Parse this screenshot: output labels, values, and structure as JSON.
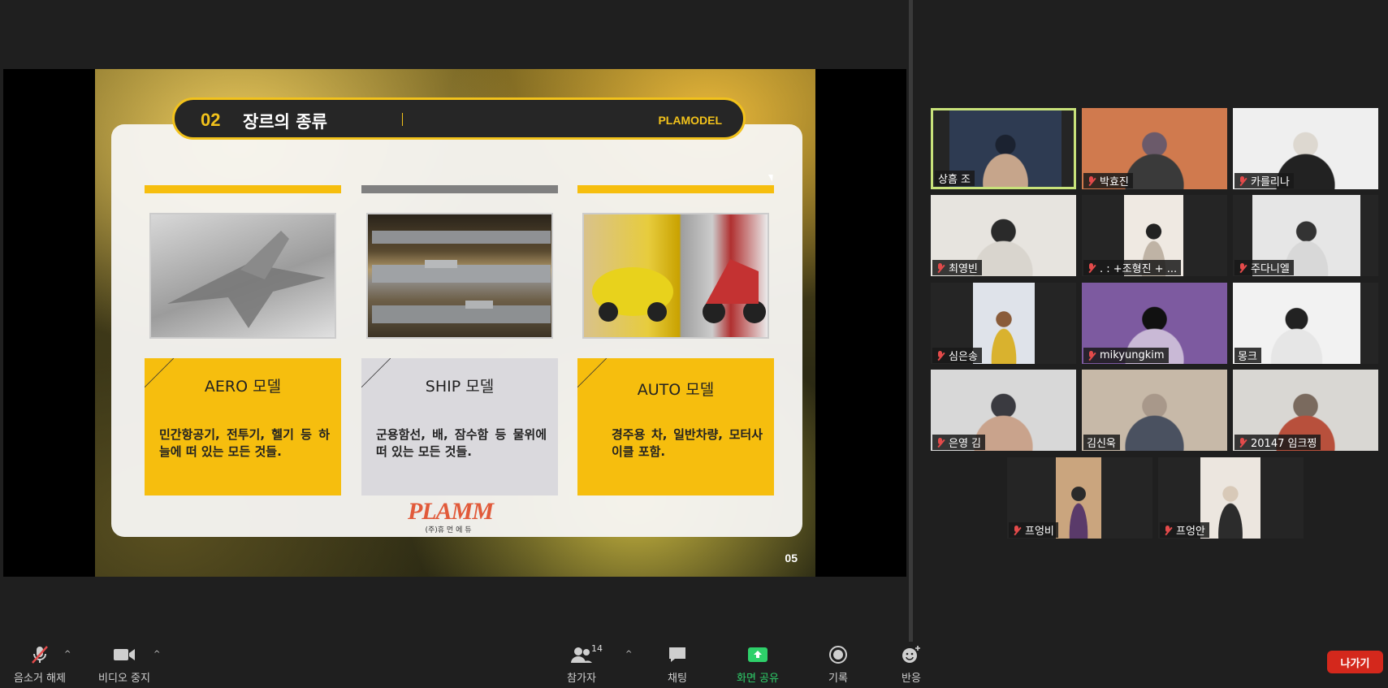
{
  "slide": {
    "number_label": "02",
    "title": "장르의 종류",
    "brand": "PLAMODEL",
    "page": "05",
    "columns": [
      {
        "title": "AERO 모델",
        "desc": "민간항공기, 전투기, 헬기 등 하늘에 떠 있는 모든 것들.",
        "image": "fighter-jet-model"
      },
      {
        "title": "SHIP 모델",
        "desc": "군용함선, 배, 잠수함 등 물위에 떠 있는 모든 것들.",
        "image": "warship-models"
      },
      {
        "title": "AUTO 모델",
        "desc": "경주용 차, 일반차량, 모터사이클 포함.",
        "image": "car-and-motorcycle-models"
      }
    ],
    "logo": {
      "word": "PLAMM",
      "sub": "(주)휴 먼 에 듀"
    }
  },
  "participants": [
    {
      "name": "상흠 조",
      "muted": false,
      "active": true,
      "colors": [
        "#2e3b52",
        "#c6a58b",
        "#1b2230"
      ]
    },
    {
      "name": "박효진",
      "muted": true,
      "active": false,
      "colors": [
        "#d07a4e",
        "#3a3a3a",
        "#6b5a6a"
      ]
    },
    {
      "name": "카를리나",
      "muted": true,
      "active": false,
      "colors": [
        "#efefef",
        "#222222",
        "#ddd8d0"
      ]
    },
    {
      "name": "최영빈",
      "muted": true,
      "active": false,
      "colors": [
        "#e7e4df",
        "#d9d5ce",
        "#2a2a2a"
      ]
    },
    {
      "name": ".      :   +조형진 +   ...",
      "muted": true,
      "active": false,
      "colors": [
        "#efe9e2",
        "#bfb3a5",
        "#222"
      ]
    },
    {
      "name": "주다니엘",
      "muted": true,
      "active": false,
      "colors": [
        "#e6e6e6",
        "#d8d8d8",
        "#333"
      ]
    },
    {
      "name": "심은송",
      "muted": true,
      "active": false,
      "colors": [
        "#dfe3ea",
        "#d9b22e",
        "#8a5c3a"
      ]
    },
    {
      "name": "mikyungkim",
      "muted": true,
      "active": false,
      "colors": [
        "#7d5aa0",
        "#c9b9d6",
        "#111"
      ]
    },
    {
      "name": "몽크",
      "muted": false,
      "active": false,
      "colors": [
        "#f2f2f2",
        "#e6e6e6",
        "#222"
      ]
    },
    {
      "name": "은영 김",
      "muted": true,
      "active": false,
      "colors": [
        "#d8d8d8",
        "#c9a38c",
        "#3a3a40"
      ]
    },
    {
      "name": "김신욱",
      "muted": false,
      "active": false,
      "colors": [
        "#c7b9a8",
        "#4a5160",
        "#a8988a"
      ]
    },
    {
      "name": "20147 임크찡",
      "muted": true,
      "active": false,
      "colors": [
        "#d9d7d3",
        "#b8503c",
        "#7a6a5e"
      ]
    },
    {
      "name": "프엉비",
      "muted": true,
      "active": false,
      "colors": [
        "#caa57e",
        "#5a3a6a",
        "#2a2a2a"
      ]
    },
    {
      "name": "프엉안",
      "muted": true,
      "active": false,
      "colors": [
        "#ece6df",
        "#2c2c2c",
        "#d8c9b8"
      ]
    }
  ],
  "toolbar": {
    "audio": "음소거 해제",
    "video": "비디오 중지",
    "participants": "참가자",
    "participants_count": "14",
    "chat": "채팅",
    "share": "화면 공유",
    "record": "기록",
    "reactions": "반응",
    "leave": "나가기"
  },
  "colors": {
    "accent": "#f6be0e",
    "share_green": "#2ed06a",
    "leave_red": "#d4281c",
    "active_border": "#c8e27a"
  }
}
